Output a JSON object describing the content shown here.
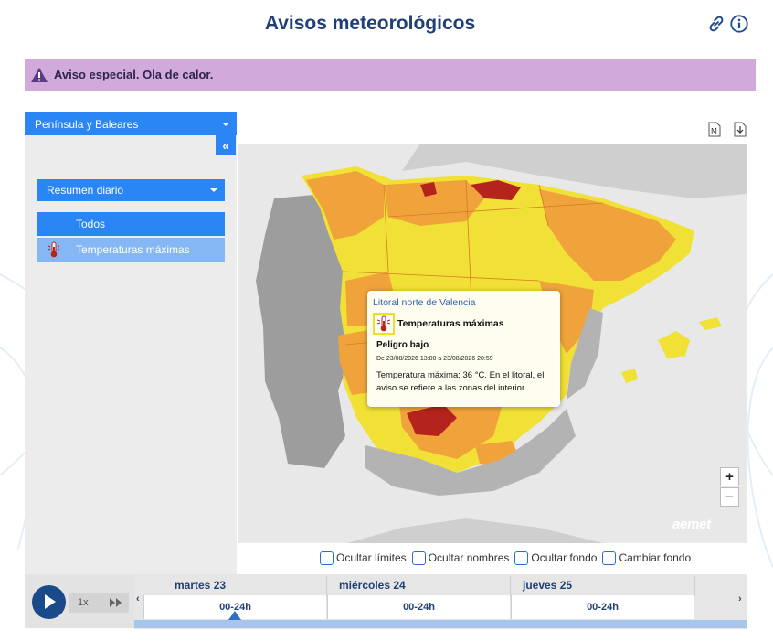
{
  "header": {
    "title": "Avisos meteorológicos"
  },
  "alert": {
    "text": "Aviso especial. Ola de calor."
  },
  "sidebar": {
    "region_select": "Península y Baleares",
    "collapse_label": "«",
    "summary_select": "Resumen diario",
    "items": [
      {
        "label": "Todos"
      },
      {
        "label": "Temperaturas máximas"
      }
    ]
  },
  "map": {
    "zoom_in": "+",
    "zoom_out": "−",
    "logo": "aemet",
    "export_label": "M",
    "colors": {
      "yellow": "#f1e036",
      "orange": "#f0a33a",
      "red": "#b5231d",
      "gray": "#b3b3b3",
      "sea": "#e8e8e8"
    },
    "popup": {
      "zone": "Litoral norte de Valencia",
      "type": "Temperaturas máximas",
      "level": "Peligro bajo",
      "dates": "De 23/08/2026 13:00 a 23/08/2026 20:59",
      "description": "Temperatura máxima: 36 °C. En el litoral, el aviso se refiere a las zonas del interior."
    }
  },
  "options": [
    {
      "label": "Ocultar límites"
    },
    {
      "label": "Ocultar nombres"
    },
    {
      "label": "Ocultar fondo"
    },
    {
      "label": "Cambiar fondo"
    }
  ],
  "player": {
    "speed": "1x"
  },
  "timeline": {
    "left_arrow": "‹",
    "right_arrow": "›",
    "days": [
      {
        "name": "martes 23",
        "range": "00-24h"
      },
      {
        "name": "miércoles 24",
        "range": "00-24h"
      },
      {
        "name": "jueves 25",
        "range": "00-24h"
      }
    ]
  }
}
